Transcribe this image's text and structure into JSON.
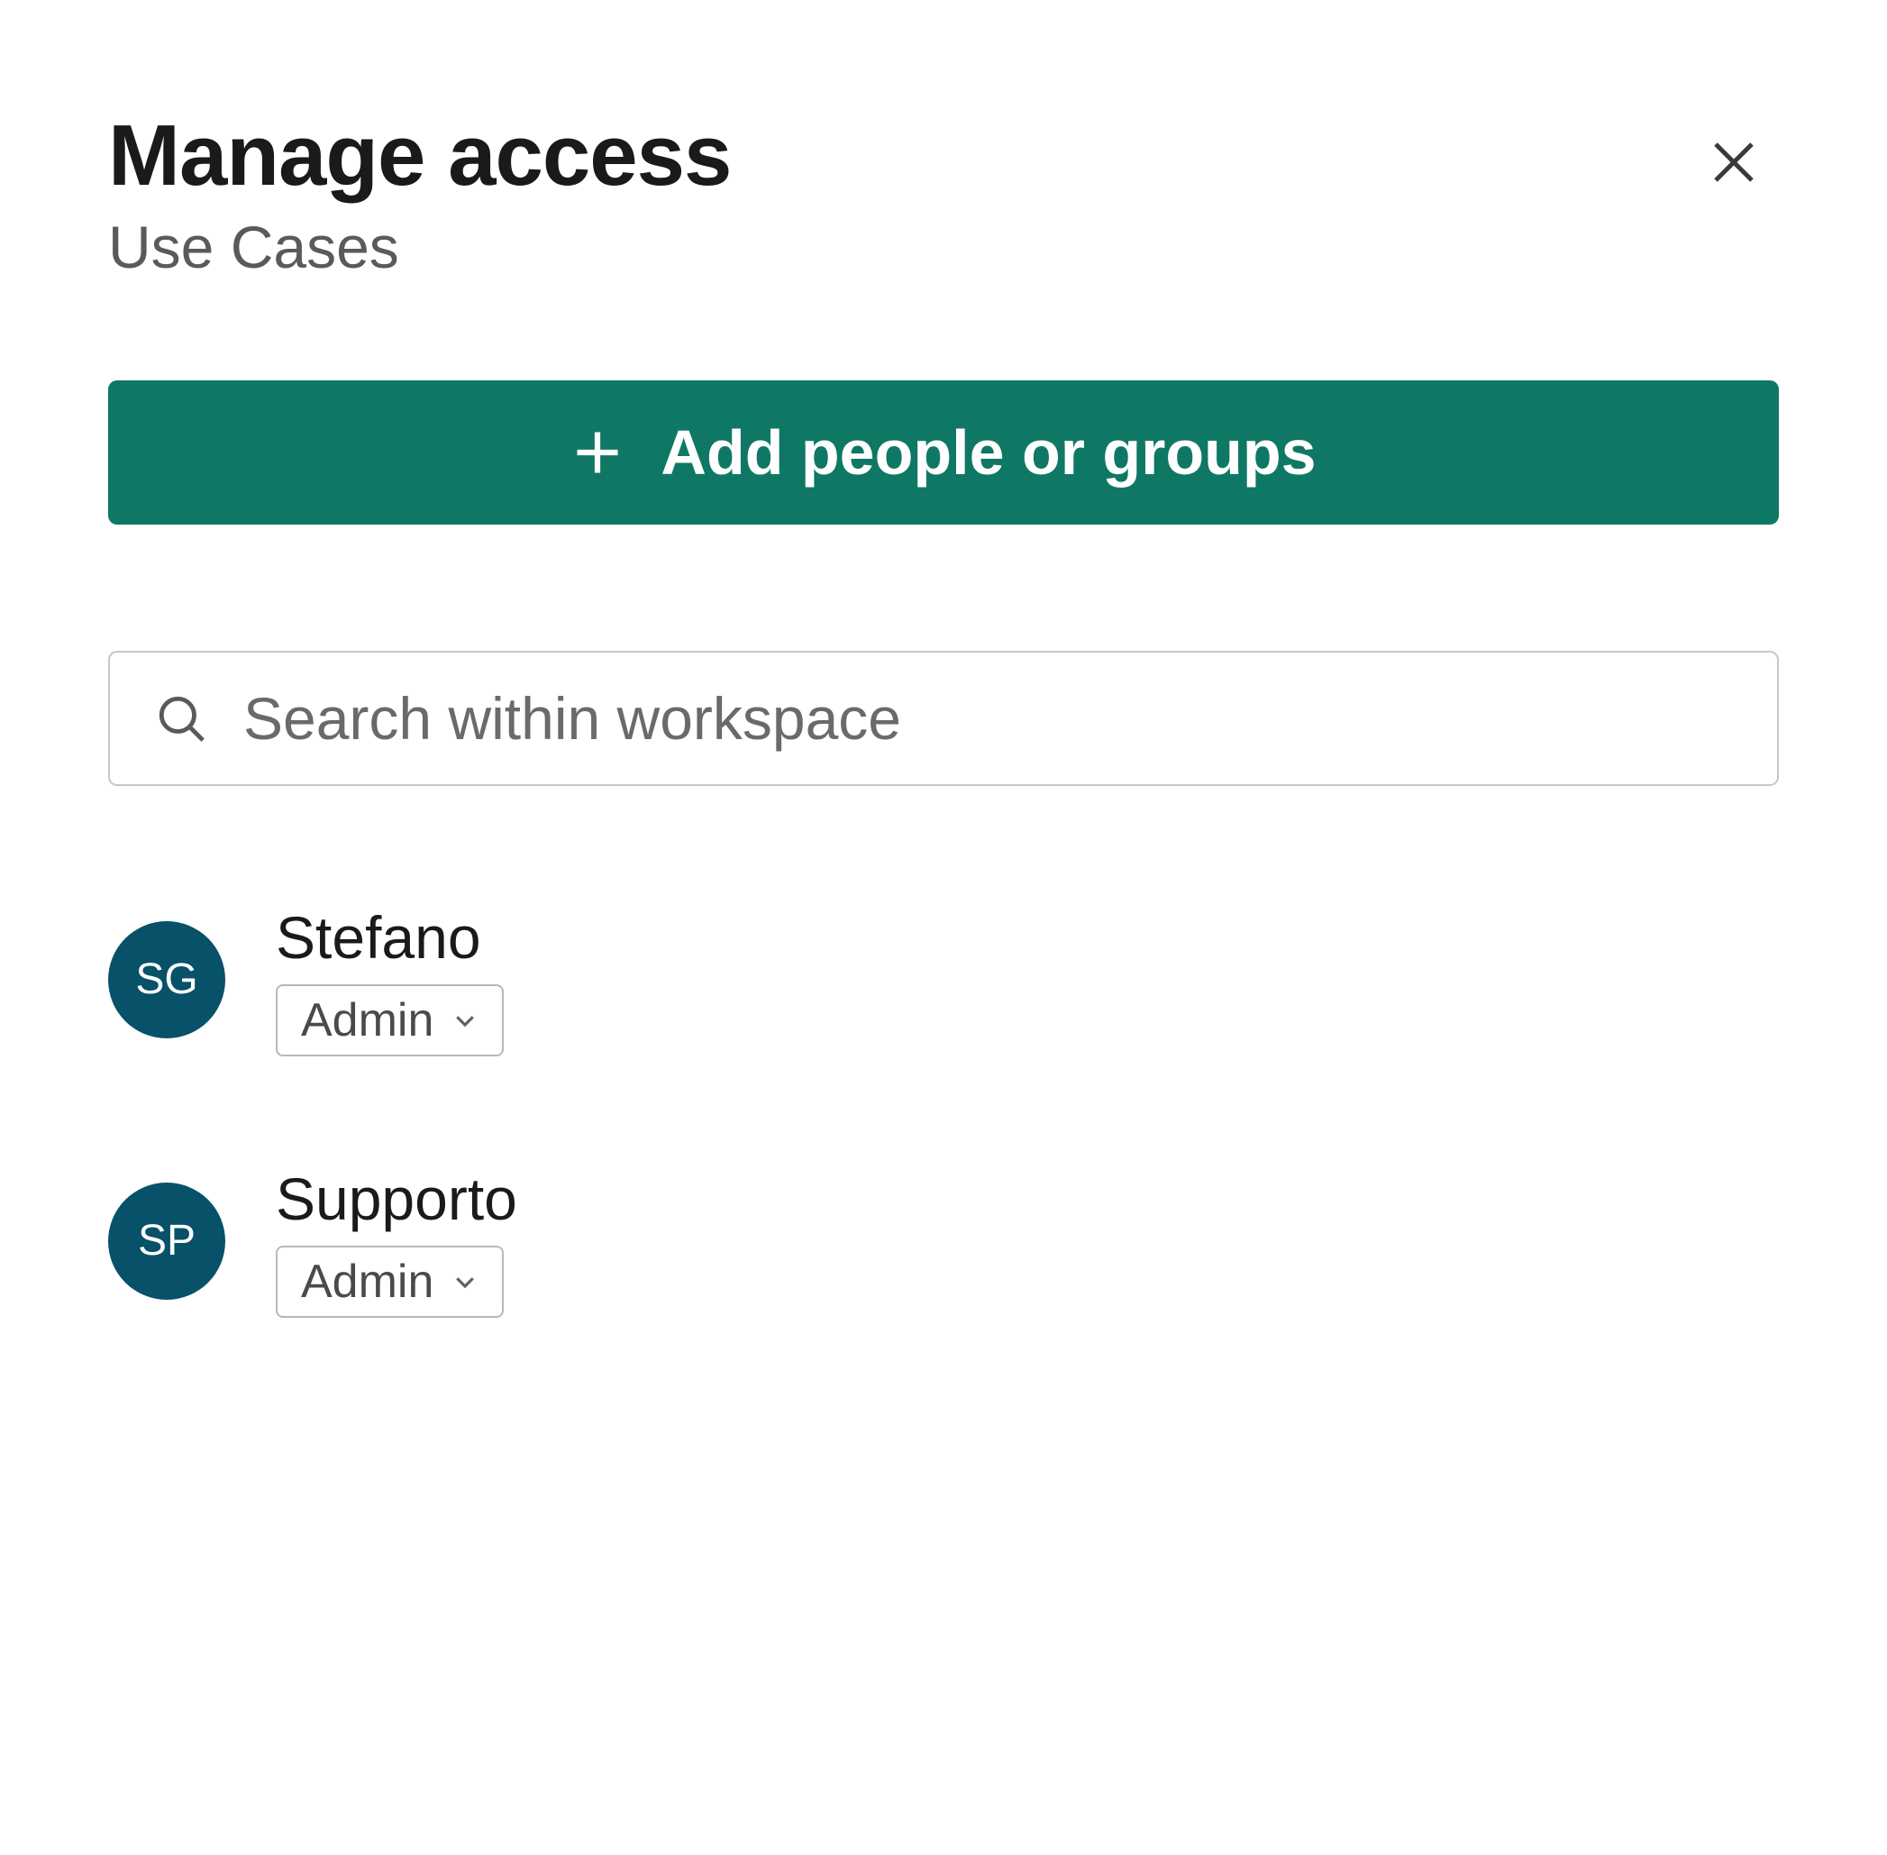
{
  "header": {
    "title": "Manage access",
    "subtitle": "Use Cases"
  },
  "actions": {
    "add_label": "Add people or groups"
  },
  "search": {
    "placeholder": "Search within workspace",
    "value": ""
  },
  "colors": {
    "primary_button": "#0f7864",
    "avatar_bg": "#075169"
  },
  "users": [
    {
      "initials": "SG",
      "name": "Stefano",
      "role": "Admin"
    },
    {
      "initials": "SP",
      "name": "Supporto",
      "role": "Admin"
    }
  ]
}
